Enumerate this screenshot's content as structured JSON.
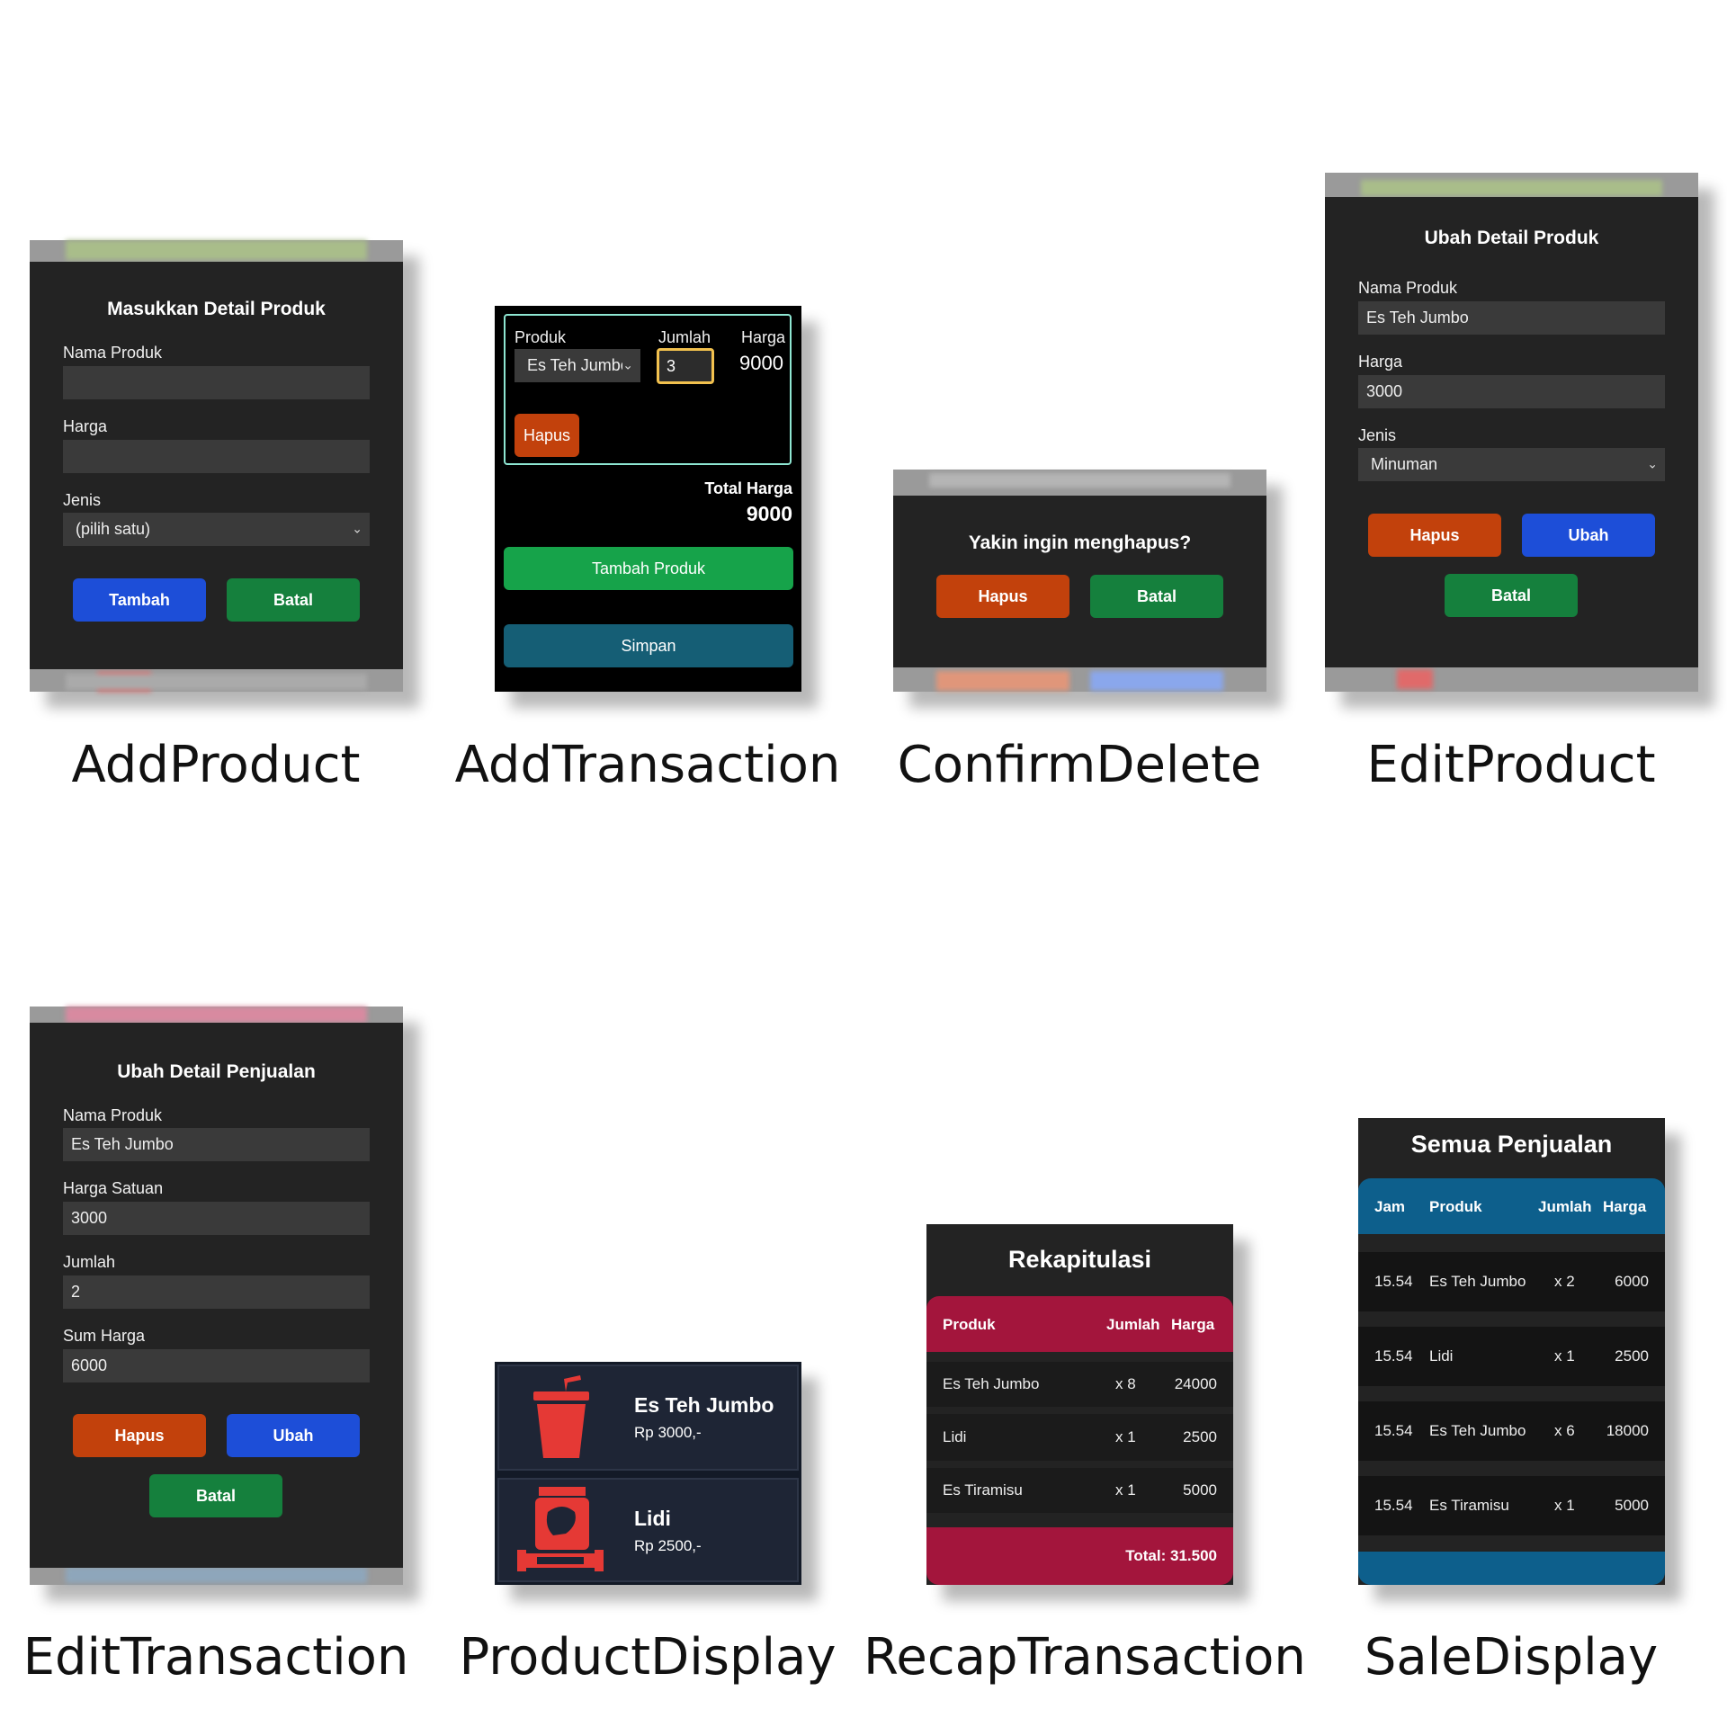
{
  "captions": {
    "add_product": "AddProduct",
    "add_transaction": "AddTransaction",
    "confirm_delete": "ConfirmDelete",
    "edit_product": "EditProduct",
    "edit_transaction": "EditTransaction",
    "product_display": "ProductDisplay",
    "recap_transaction": "RecapTransaction",
    "sale_display": "SaleDisplay"
  },
  "add_product": {
    "title": "Masukkan Detail Produk",
    "name_label": "Nama Produk",
    "name_value": "",
    "price_label": "Harga",
    "price_value": "",
    "type_label": "Jenis",
    "type_value": "(pilih satu)",
    "add_button": "Tambah",
    "cancel_button": "Batal"
  },
  "add_transaction": {
    "product_label": "Produk",
    "qty_label": "Jumlah",
    "price_label": "Harga",
    "product_value": "Es Teh Jumbo",
    "qty_value": "3",
    "price_value": "9000",
    "delete_button": "Hapus",
    "total_label": "Total Harga",
    "total_value": "9000",
    "add_product_button": "Tambah Produk",
    "save_button": "Simpan"
  },
  "confirm_delete": {
    "question": "Yakin ingin menghapus?",
    "delete_button": "Hapus",
    "cancel_button": "Batal"
  },
  "edit_product": {
    "title": "Ubah Detail Produk",
    "name_label": "Nama Produk",
    "name_value": "Es Teh Jumbo",
    "price_label": "Harga",
    "price_value": "3000",
    "type_label": "Jenis",
    "type_value": "Minuman",
    "delete_button": "Hapus",
    "edit_button": "Ubah",
    "cancel_button": "Batal"
  },
  "edit_transaction": {
    "title": "Ubah Detail Penjualan",
    "name_label": "Nama Produk",
    "name_value": "Es Teh Jumbo",
    "unit_price_label": "Harga Satuan",
    "unit_price_value": "3000",
    "qty_label": "Jumlah",
    "qty_value": "2",
    "sum_label": "Sum Harga",
    "sum_value": "6000",
    "delete_button": "Hapus",
    "edit_button": "Ubah",
    "cancel_button": "Batal"
  },
  "product_display": {
    "items": [
      {
        "name": "Es Teh Jumbo",
        "price": "Rp 3000,-",
        "icon": "drink-cup-icon"
      },
      {
        "name": "Lidi",
        "price": "Rp 2500,-",
        "icon": "snack-pack-icon"
      }
    ]
  },
  "recap_transaction": {
    "title": "Rekapitulasi",
    "headers": [
      "Produk",
      "Jumlah",
      "Harga"
    ],
    "rows": [
      {
        "product": "Es Teh Jumbo",
        "qty": "x 8",
        "price": "24000"
      },
      {
        "product": "Lidi",
        "qty": "x 1",
        "price": "2500"
      },
      {
        "product": "Es Tiramisu",
        "qty": "x 1",
        "price": "5000"
      }
    ],
    "total": "Total: 31.500"
  },
  "sale_display": {
    "title": "Semua Penjualan",
    "headers": [
      "Jam",
      "Produk",
      "Jumlah",
      "Harga"
    ],
    "rows": [
      {
        "time": "15.54",
        "product": "Es Teh Jumbo",
        "qty": "x 2",
        "price": "6000"
      },
      {
        "time": "15.54",
        "product": "Lidi",
        "qty": "x 1",
        "price": "2500"
      },
      {
        "time": "15.54",
        "product": "Es Teh Jumbo",
        "qty": "x 6",
        "price": "18000"
      },
      {
        "time": "15.54",
        "product": "Es Tiramisu",
        "qty": "x 1",
        "price": "5000"
      }
    ]
  },
  "colors": {
    "card_bg": "#232323",
    "field_bg": "#3a3a3a",
    "red": "#c2410c",
    "blue": "#1d4ed8",
    "green": "#15803d",
    "recap_accent": "#a3153c",
    "sale_accent": "#0d5f8c",
    "product_card": "#1e2535",
    "icon_red": "#e53935"
  }
}
